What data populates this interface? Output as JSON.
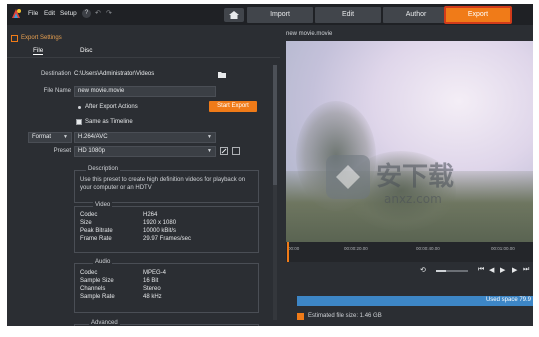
{
  "menu": {
    "file": "File",
    "edit": "Edit",
    "setup": "Setup"
  },
  "tabs": {
    "import": "Import",
    "edit": "Edit",
    "author": "Author",
    "export": "Export"
  },
  "panel": {
    "title": "Export Settings",
    "subtab_file": "File",
    "subtab_disc": "Disc"
  },
  "form": {
    "destination_label": "Destination",
    "destination_value": "C:\\Users\\Administrator\\Videos",
    "filename_label": "File Name",
    "filename_value": "new movie.movie",
    "after_export": "After Export Actions",
    "start_export": "Start Export",
    "same_as_timeline": "Same as Timeline",
    "format_label": "Format",
    "format_value": "H.264/AVC",
    "preset_label": "Preset",
    "preset_value": "HD 1080p"
  },
  "description": {
    "title": "Description",
    "text": "Use this preset to create high definition videos for playback on your computer or an HDTV"
  },
  "video_info": {
    "title": "Video",
    "rows": [
      {
        "label": "Codec",
        "value": "H264"
      },
      {
        "label": "Size",
        "value": "1920 x 1080"
      },
      {
        "label": "Peak Bitrate",
        "value": "10000 kBit/s"
      },
      {
        "label": "Frame Rate",
        "value": "29.97 Frames/sec"
      }
    ]
  },
  "audio_info": {
    "title": "Audio",
    "rows": [
      {
        "label": "Codec",
        "value": "MPEG-4"
      },
      {
        "label": "Sample Size",
        "value": "16 Bit"
      },
      {
        "label": "Channels",
        "value": "Stereo"
      },
      {
        "label": "Sample Rate",
        "value": "48 kHz"
      }
    ]
  },
  "advanced": {
    "title": "Advanced"
  },
  "preview": {
    "title": "new movie.movie",
    "ticks": [
      "00:00",
      "00:00:20.00",
      "00:00:40.00",
      "00:01:00.00"
    ],
    "used_space": "Used space 79.9",
    "estimated_size": "Estimated file size: 1.46 GB"
  }
}
